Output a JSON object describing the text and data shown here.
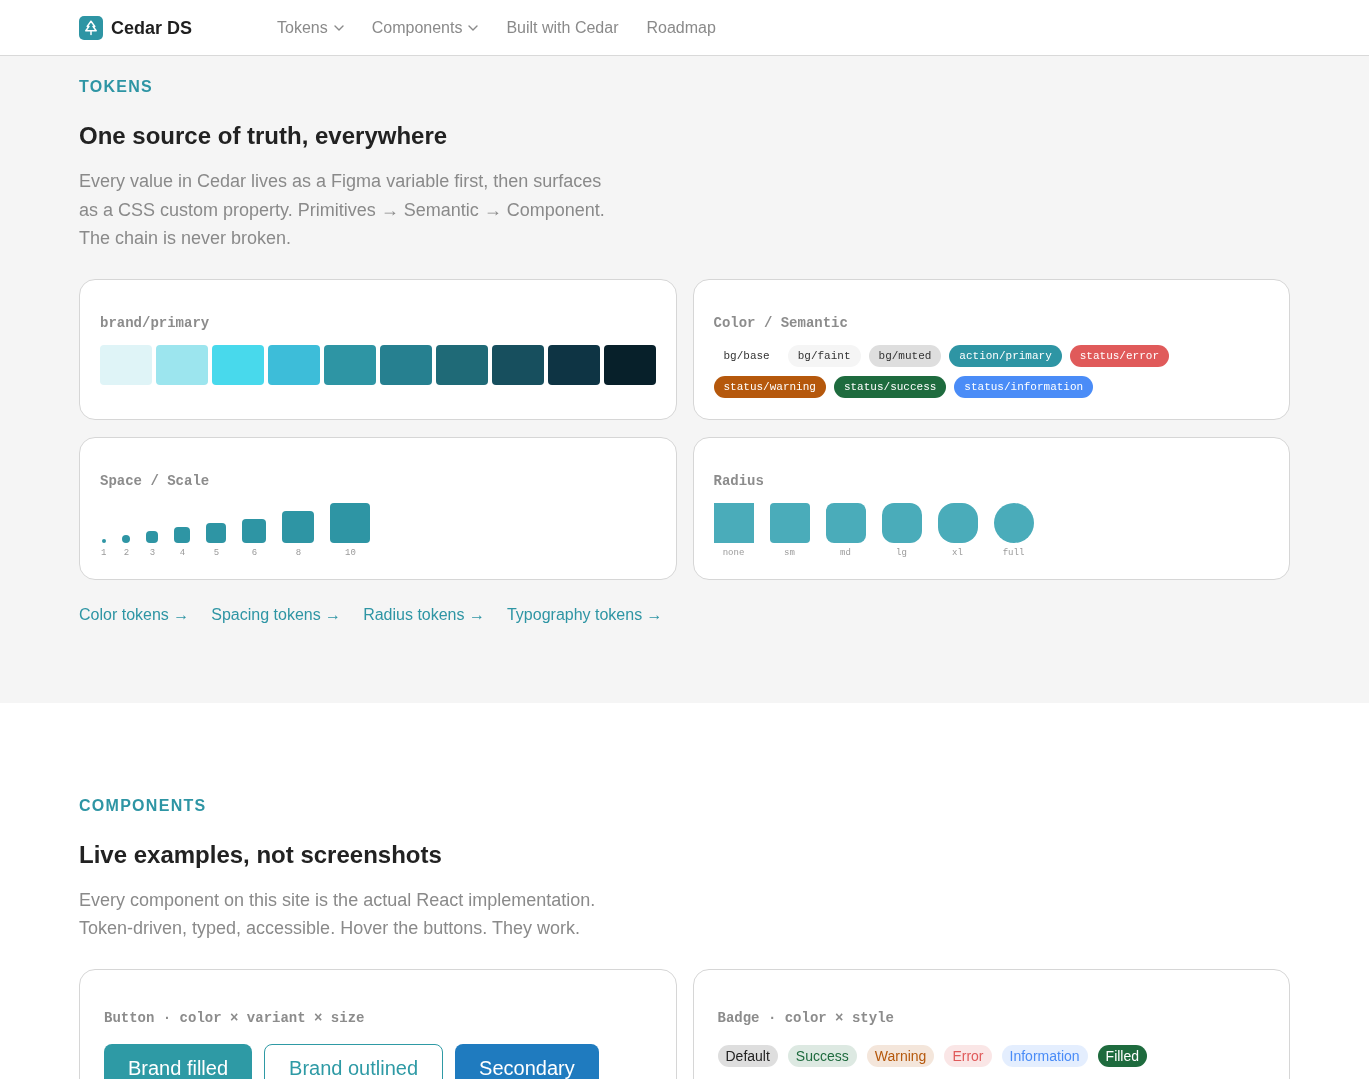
{
  "header": {
    "logo": "Cedar DS",
    "nav": [
      {
        "label": "Tokens",
        "dropdown": true
      },
      {
        "label": "Components",
        "dropdown": true
      },
      {
        "label": "Built with Cedar",
        "dropdown": false
      },
      {
        "label": "Roadmap",
        "dropdown": false
      }
    ]
  },
  "sections": [
    {
      "kind": "tokens",
      "eyebrow": "TOKENS",
      "heading": "One source of truth, everywhere",
      "intro": "Every value in Cedar lives as a Figma variable first, then surfaces as a CSS custom property. Primitives → Semantic → Component. The chain is never broken.",
      "cards": [
        {
          "kind": "palette",
          "title": "brand/primary",
          "swatches": [
            {
              "color": "#dff4f7"
            },
            {
              "color": "#9ce5ee"
            },
            {
              "color": "#48d9ec"
            },
            {
              "color": "#3dbdd9"
            },
            {
              "color": "#2e95a4"
            },
            {
              "color": "#268090"
            },
            {
              "color": "#1f6a77"
            },
            {
              "color": "#174f5e"
            },
            {
              "color": "#0e3444"
            },
            {
              "color": "#07202a"
            }
          ]
        },
        {
          "kind": "chips",
          "title": "Color / Semantic",
          "chips": [
            {
              "label": "bg/base",
              "color": "#ffffff"
            },
            {
              "label": "bg/faint",
              "color": "#f5f5f5"
            },
            {
              "label": "bg/muted",
              "color": "#dedede"
            },
            {
              "label": "action/primary",
              "color": "#2e95a4"
            },
            {
              "label": "status/error",
              "color": "#e05a5a"
            },
            {
              "label": "status/warning",
              "color": "#b5580c"
            },
            {
              "label": "status/success",
              "color": "#1e6b3e"
            },
            {
              "label": "status/information",
              "color": "#4a8cf7"
            }
          ]
        },
        {
          "kind": "scale",
          "title": "Space / Scale",
          "steps": [
            {
              "label": "1"
            },
            {
              "label": "2"
            },
            {
              "label": "3"
            },
            {
              "label": "4"
            },
            {
              "label": "5"
            },
            {
              "label": "6"
            },
            {
              "label": "8"
            },
            {
              "label": "10"
            }
          ]
        },
        {
          "kind": "radius",
          "title": "Radius",
          "shapes": [
            {
              "label": "none"
            },
            {
              "label": "sm"
            },
            {
              "label": "md"
            },
            {
              "label": "lg"
            },
            {
              "label": "xl"
            },
            {
              "label": "full"
            }
          ]
        }
      ],
      "links": [
        {
          "label": "Color tokens →"
        },
        {
          "label": "Spacing tokens →"
        },
        {
          "label": "Radius tokens →"
        },
        {
          "label": "Typography tokens →"
        }
      ]
    },
    {
      "kind": "components",
      "eyebrow": "COMPONENTS",
      "heading": "Live examples, not screenshots",
      "intro": "Every component on this site is the actual React implementation. Token-driven, typed, accessible. Hover the buttons. They work.",
      "cards": [
        {
          "kind": "buttons",
          "title": "Button · color × variant × size",
          "buttons": [
            {
              "label": "Brand filled",
              "kind": "filled",
              "color": "#2e9aa5"
            },
            {
              "label": "Brand outlined",
              "kind": "outlined",
              "color": "#2e9aa5"
            },
            {
              "label": "Secondary",
              "kind": "filled",
              "color": "#1f7bbf"
            }
          ]
        },
        {
          "kind": "badges",
          "title": "Badge · color × style",
          "badges": [
            {
              "label": "Default",
              "kind": "soft",
              "color": "#222222"
            },
            {
              "label": "Success",
              "kind": "soft",
              "color": "#1e6b3e"
            },
            {
              "label": "Warning",
              "kind": "soft",
              "color": "#b5580c"
            },
            {
              "label": "Error",
              "kind": "soft",
              "color": "#e05a5a"
            },
            {
              "label": "Information",
              "kind": "soft",
              "color": "#4a8cf7"
            },
            {
              "label": "Filled",
              "kind": "filled",
              "color": "#1e6b3e"
            }
          ]
        }
      ]
    }
  ]
}
